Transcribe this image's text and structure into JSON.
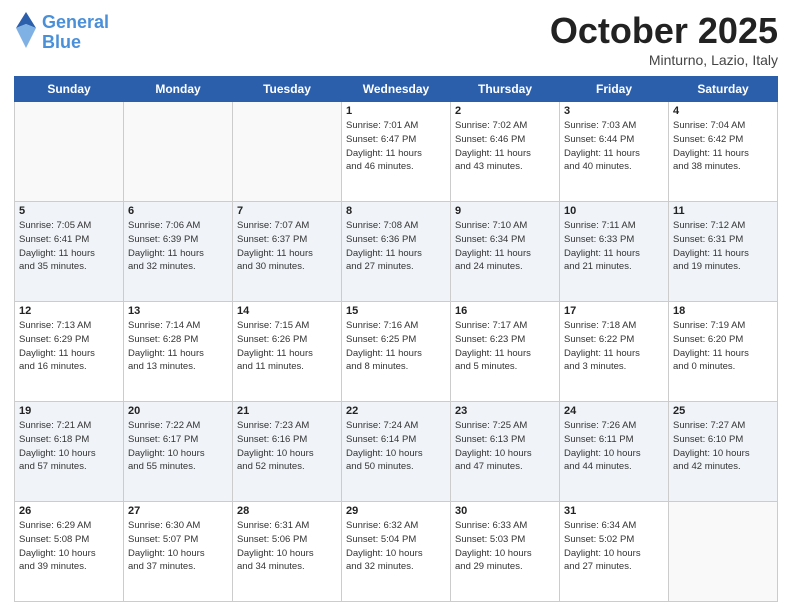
{
  "header": {
    "logo_line1": "General",
    "logo_line2": "Blue",
    "month": "October 2025",
    "location": "Minturno, Lazio, Italy"
  },
  "weekdays": [
    "Sunday",
    "Monday",
    "Tuesday",
    "Wednesday",
    "Thursday",
    "Friday",
    "Saturday"
  ],
  "weeks": [
    [
      {
        "day": "",
        "info": ""
      },
      {
        "day": "",
        "info": ""
      },
      {
        "day": "",
        "info": ""
      },
      {
        "day": "1",
        "info": "Sunrise: 7:01 AM\nSunset: 6:47 PM\nDaylight: 11 hours\nand 46 minutes."
      },
      {
        "day": "2",
        "info": "Sunrise: 7:02 AM\nSunset: 6:46 PM\nDaylight: 11 hours\nand 43 minutes."
      },
      {
        "day": "3",
        "info": "Sunrise: 7:03 AM\nSunset: 6:44 PM\nDaylight: 11 hours\nand 40 minutes."
      },
      {
        "day": "4",
        "info": "Sunrise: 7:04 AM\nSunset: 6:42 PM\nDaylight: 11 hours\nand 38 minutes."
      }
    ],
    [
      {
        "day": "5",
        "info": "Sunrise: 7:05 AM\nSunset: 6:41 PM\nDaylight: 11 hours\nand 35 minutes."
      },
      {
        "day": "6",
        "info": "Sunrise: 7:06 AM\nSunset: 6:39 PM\nDaylight: 11 hours\nand 32 minutes."
      },
      {
        "day": "7",
        "info": "Sunrise: 7:07 AM\nSunset: 6:37 PM\nDaylight: 11 hours\nand 30 minutes."
      },
      {
        "day": "8",
        "info": "Sunrise: 7:08 AM\nSunset: 6:36 PM\nDaylight: 11 hours\nand 27 minutes."
      },
      {
        "day": "9",
        "info": "Sunrise: 7:10 AM\nSunset: 6:34 PM\nDaylight: 11 hours\nand 24 minutes."
      },
      {
        "day": "10",
        "info": "Sunrise: 7:11 AM\nSunset: 6:33 PM\nDaylight: 11 hours\nand 21 minutes."
      },
      {
        "day": "11",
        "info": "Sunrise: 7:12 AM\nSunset: 6:31 PM\nDaylight: 11 hours\nand 19 minutes."
      }
    ],
    [
      {
        "day": "12",
        "info": "Sunrise: 7:13 AM\nSunset: 6:29 PM\nDaylight: 11 hours\nand 16 minutes."
      },
      {
        "day": "13",
        "info": "Sunrise: 7:14 AM\nSunset: 6:28 PM\nDaylight: 11 hours\nand 13 minutes."
      },
      {
        "day": "14",
        "info": "Sunrise: 7:15 AM\nSunset: 6:26 PM\nDaylight: 11 hours\nand 11 minutes."
      },
      {
        "day": "15",
        "info": "Sunrise: 7:16 AM\nSunset: 6:25 PM\nDaylight: 11 hours\nand 8 minutes."
      },
      {
        "day": "16",
        "info": "Sunrise: 7:17 AM\nSunset: 6:23 PM\nDaylight: 11 hours\nand 5 minutes."
      },
      {
        "day": "17",
        "info": "Sunrise: 7:18 AM\nSunset: 6:22 PM\nDaylight: 11 hours\nand 3 minutes."
      },
      {
        "day": "18",
        "info": "Sunrise: 7:19 AM\nSunset: 6:20 PM\nDaylight: 11 hours\nand 0 minutes."
      }
    ],
    [
      {
        "day": "19",
        "info": "Sunrise: 7:21 AM\nSunset: 6:18 PM\nDaylight: 10 hours\nand 57 minutes."
      },
      {
        "day": "20",
        "info": "Sunrise: 7:22 AM\nSunset: 6:17 PM\nDaylight: 10 hours\nand 55 minutes."
      },
      {
        "day": "21",
        "info": "Sunrise: 7:23 AM\nSunset: 6:16 PM\nDaylight: 10 hours\nand 52 minutes."
      },
      {
        "day": "22",
        "info": "Sunrise: 7:24 AM\nSunset: 6:14 PM\nDaylight: 10 hours\nand 50 minutes."
      },
      {
        "day": "23",
        "info": "Sunrise: 7:25 AM\nSunset: 6:13 PM\nDaylight: 10 hours\nand 47 minutes."
      },
      {
        "day": "24",
        "info": "Sunrise: 7:26 AM\nSunset: 6:11 PM\nDaylight: 10 hours\nand 44 minutes."
      },
      {
        "day": "25",
        "info": "Sunrise: 7:27 AM\nSunset: 6:10 PM\nDaylight: 10 hours\nand 42 minutes."
      }
    ],
    [
      {
        "day": "26",
        "info": "Sunrise: 6:29 AM\nSunset: 5:08 PM\nDaylight: 10 hours\nand 39 minutes."
      },
      {
        "day": "27",
        "info": "Sunrise: 6:30 AM\nSunset: 5:07 PM\nDaylight: 10 hours\nand 37 minutes."
      },
      {
        "day": "28",
        "info": "Sunrise: 6:31 AM\nSunset: 5:06 PM\nDaylight: 10 hours\nand 34 minutes."
      },
      {
        "day": "29",
        "info": "Sunrise: 6:32 AM\nSunset: 5:04 PM\nDaylight: 10 hours\nand 32 minutes."
      },
      {
        "day": "30",
        "info": "Sunrise: 6:33 AM\nSunset: 5:03 PM\nDaylight: 10 hours\nand 29 minutes."
      },
      {
        "day": "31",
        "info": "Sunrise: 6:34 AM\nSunset: 5:02 PM\nDaylight: 10 hours\nand 27 minutes."
      },
      {
        "day": "",
        "info": ""
      }
    ]
  ]
}
